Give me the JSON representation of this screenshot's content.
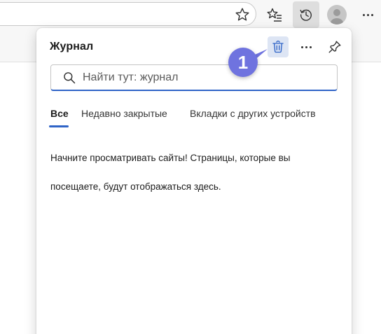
{
  "browser": {
    "icons": {
      "favorite": "star-outline-icon",
      "favorites_list": "favorites-icon",
      "history": "history-icon",
      "profile": "avatar",
      "more": "more-horizontal-icon"
    }
  },
  "history_panel": {
    "title": "Журнал",
    "search": {
      "placeholder": "Найти тут: журнал",
      "value": ""
    },
    "tabs": [
      {
        "label": "Все",
        "selected": true
      },
      {
        "label": "Недавно закрытые",
        "selected": false
      },
      {
        "label": "Вкладки с других устройств",
        "selected": false
      }
    ],
    "empty_message": {
      "line1": "Начните просматривать сайты! Страницы, которые вы",
      "line2": "посещаете, будут отображаться здесь."
    },
    "icons": {
      "delete": "trash-icon",
      "more": "more-horizontal-icon",
      "pin": "pin-icon"
    }
  },
  "annotation": {
    "step_number": "1",
    "color": "#6f73df"
  },
  "colors": {
    "accent": "#2f64c7",
    "delete_button_bg": "#dde5f4",
    "toolbar_bg": "#f7f7f7"
  }
}
